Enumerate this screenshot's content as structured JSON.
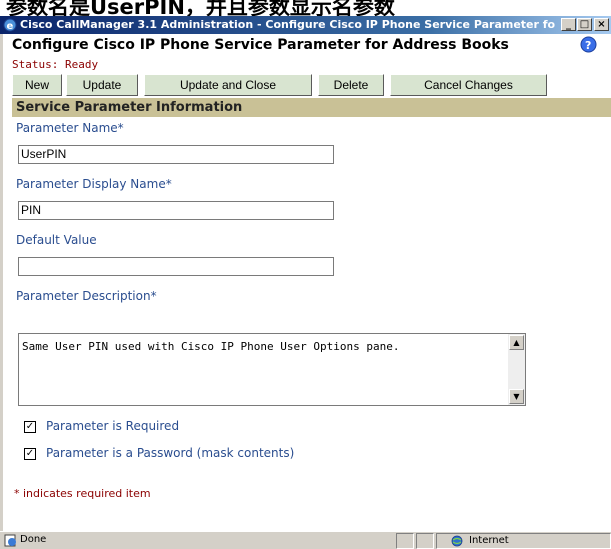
{
  "caption": "参数名是UserPIN，并且参数显示名参数",
  "window": {
    "title": "Cisco CallManager 3.1 Administration - Configure Cisco IP Phone Service Parameter fo...",
    "minimize": "_",
    "maximize": "□",
    "close": "×"
  },
  "page": {
    "title": "Configure Cisco IP Phone Service Parameter for Address Books",
    "status": "Status: Ready"
  },
  "toolbar": {
    "new": "New",
    "update": "Update",
    "update_close": "Update and Close",
    "delete": "Delete",
    "cancel": "Cancel Changes"
  },
  "section_title": "Service Parameter Information",
  "fields": {
    "name_label": "Parameter Name*",
    "name_value": "UserPIN",
    "display_label": "Parameter Display Name*",
    "display_value": "PIN",
    "default_label": "Default Value",
    "default_value": "",
    "desc_label": "Parameter Description*",
    "desc_value": "Same User PIN used with Cisco IP Phone User Options pane."
  },
  "checkboxes": {
    "required_label": "Parameter is Required",
    "required_checked": true,
    "password_label": "Parameter is a Password (mask contents)",
    "password_checked": true
  },
  "required_note": "* indicates required item",
  "statusbar": {
    "left": "Done",
    "zone": "Internet"
  }
}
